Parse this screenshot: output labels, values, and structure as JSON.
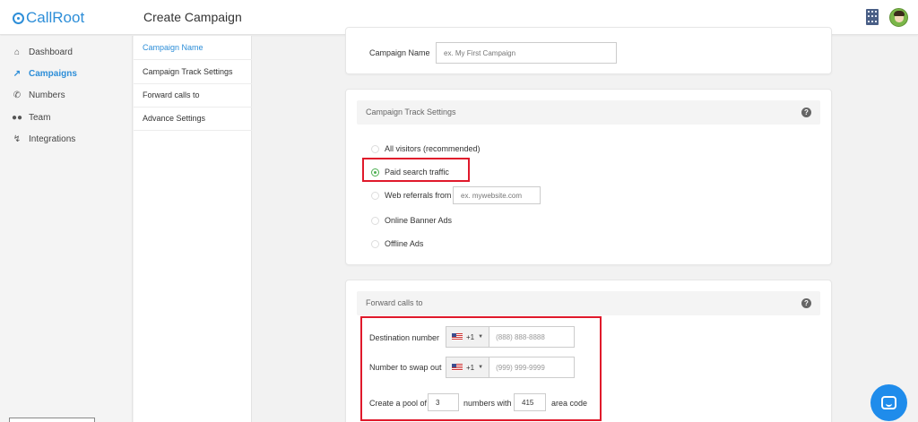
{
  "app": {
    "logo_text": "CallRoot",
    "page_title": "Create Campaign"
  },
  "sidebar": {
    "items": [
      {
        "label": "Dashboard",
        "icon": "home-icon"
      },
      {
        "label": "Campaigns",
        "icon": "chart-line-icon",
        "active": true
      },
      {
        "label": "Numbers",
        "icon": "phone-icon"
      },
      {
        "label": "Team",
        "icon": "team-icon"
      },
      {
        "label": "Integrations",
        "icon": "integrations-icon"
      }
    ]
  },
  "sections": {
    "items": [
      {
        "label": "Campaign Name",
        "active": true
      },
      {
        "label": "Campaign Track Settings"
      },
      {
        "label": "Forward calls to"
      },
      {
        "label": "Advance Settings"
      }
    ]
  },
  "campaign_name": {
    "label": "Campaign Name",
    "placeholder": "ex. My First Campaign"
  },
  "track_settings": {
    "title": "Campaign Track Settings",
    "options": [
      {
        "label": "All visitors (recommended)",
        "checked": false
      },
      {
        "label": "Paid search traffic",
        "checked": true
      },
      {
        "label": "Web referrals from",
        "checked": false
      },
      {
        "label": "Online Banner Ads",
        "checked": false
      },
      {
        "label": "Offline Ads",
        "checked": false
      }
    ],
    "referral_placeholder": "ex. mywebsite.com"
  },
  "forward_calls": {
    "title": "Forward calls to",
    "destination_label": "Destination number",
    "destination_code": "+1",
    "destination_placeholder": "(888) 888-8888",
    "swap_label": "Number to swap out",
    "swap_code": "+1",
    "swap_placeholder": "(999) 999-9999",
    "pool_prefix": "Create a pool of",
    "pool_count": "3",
    "pool_middle": "numbers with",
    "area_code": "415",
    "pool_suffix": "area code"
  },
  "colors": {
    "accent": "#2d8ed8",
    "highlight": "#e0192b",
    "radio_checked": "#4caf50"
  }
}
